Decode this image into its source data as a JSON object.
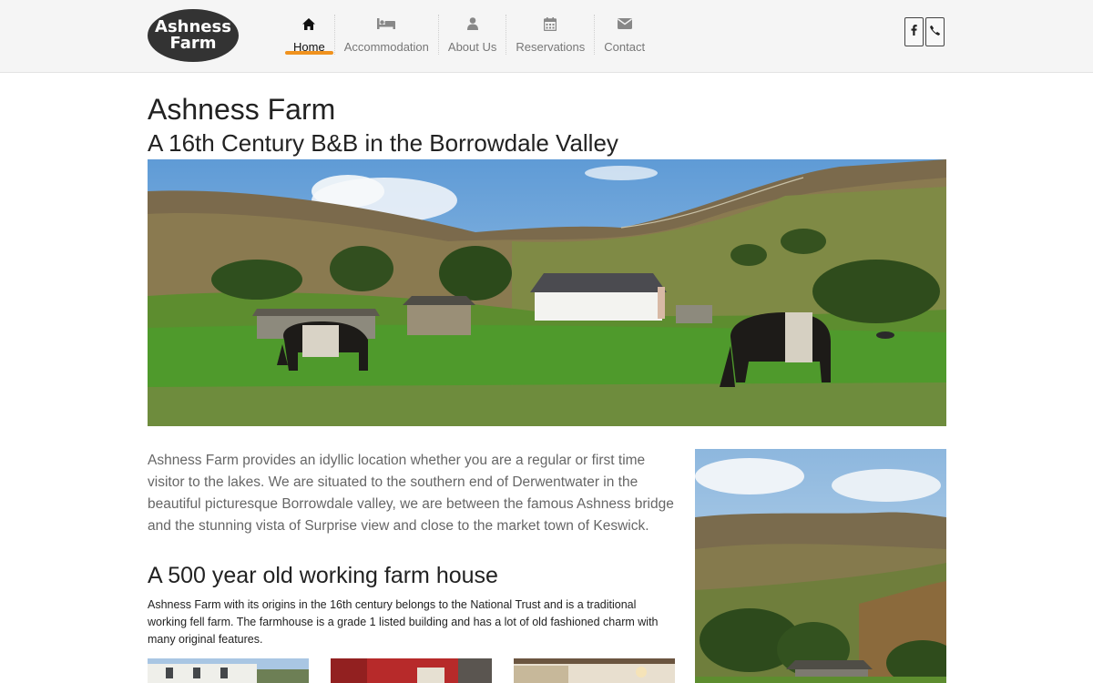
{
  "logo": {
    "line1": "Ashness",
    "line2": "Farm"
  },
  "nav": {
    "items": [
      {
        "label": "Home",
        "icon": "home-icon"
      },
      {
        "label": "Accommodation",
        "icon": "bed-icon"
      },
      {
        "label": "About Us",
        "icon": "user-icon"
      },
      {
        "label": "Reservations",
        "icon": "calendar-icon"
      },
      {
        "label": "Contact",
        "icon": "envelope-icon"
      }
    ],
    "active": "Home"
  },
  "social": {
    "icons": [
      "facebook-icon",
      "phone-icon"
    ]
  },
  "main": {
    "title": "Ashness Farm",
    "subtitle": "A 16th Century B&B in the Borrowdale Valley",
    "intro": "Ashness Farm provides an idyllic location whether you are a regular or first time visitor to the lakes. We are situated to the southern end of Derwentwater in the beautiful picturesque Borrowdale valley, we are between the famous Ashness bridge and the stunning vista of Surprise view and close to the market town of Keswick.",
    "section_title": "A 500 year old working farm house",
    "section_text": "Ashness Farm with its origins in the 16th century belongs to the National Trust and is a traditional working fell farm. The farmhouse is a grade 1 listed building and has a lot of old fashioned charm with many original features."
  },
  "colors": {
    "accent": "#f0921e",
    "header_bg": "#f5f5f5",
    "logo_bg": "#333333"
  }
}
